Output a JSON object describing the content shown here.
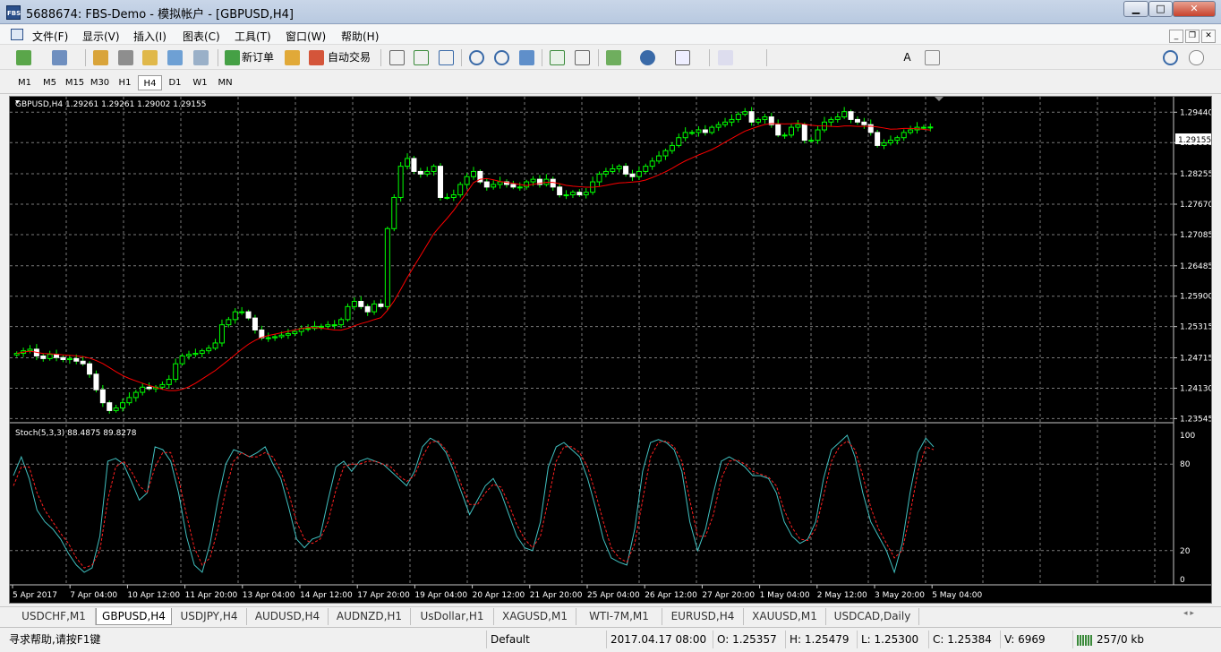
{
  "window": {
    "title": "5688674: FBS-Demo - 模拟帐户 - [GBPUSD,H4]",
    "app_icon_text": "FBS",
    "buttons": [
      "minimize-icon",
      "maximize-icon",
      "close-icon"
    ]
  },
  "menu": {
    "items": [
      "文件(F)",
      "显示(V)",
      "插入(I)",
      "图表(C)",
      "工具(T)",
      "窗口(W)",
      "帮助(H)"
    ]
  },
  "toolbar": {
    "new_order_label": "新订单",
    "auto_trade_label": "自动交易"
  },
  "timeframes": {
    "items": [
      "M1",
      "M5",
      "M15",
      "M30",
      "H1",
      "H4",
      "D1",
      "W1",
      "MN"
    ],
    "active": "H4"
  },
  "chart_data": [
    {
      "type": "candlestick",
      "title": "GBPUSD,H4  1.29261 1.29261 1.29002 1.29155",
      "symbol": "GBPUSD",
      "timeframe": "H4",
      "ohlc_last": {
        "open": 1.29261,
        "high": 1.29261,
        "low": 1.29002,
        "close": 1.29155
      },
      "current_price_label": "1.29155",
      "ylim": [
        1.235,
        1.296
      ],
      "y_ticks": [
        "1.29440",
        "1.28855",
        "1.28255",
        "1.27670",
        "1.27085",
        "1.26485",
        "1.25900",
        "1.25315",
        "1.24715",
        "1.24130",
        "1.23545"
      ],
      "grid": true,
      "bull_color": "#00ff00",
      "bear_color": "#ffffff",
      "ma_color": "#ff0000",
      "close_series": [
        1.248,
        1.2485,
        1.2488,
        1.2475,
        1.247,
        1.2478,
        1.2472,
        1.2468,
        1.247,
        1.2465,
        1.246,
        1.244,
        1.241,
        1.2385,
        1.237,
        1.2375,
        1.2385,
        1.2395,
        1.2405,
        1.2415,
        1.2412,
        1.2415,
        1.242,
        1.243,
        1.246,
        1.2475,
        1.2478,
        1.248,
        1.2485,
        1.249,
        1.25,
        1.2535,
        1.2545,
        1.256,
        1.256,
        1.2548,
        1.2525,
        1.251,
        1.251,
        1.2512,
        1.2515,
        1.2518,
        1.2522,
        1.2528,
        1.2528,
        1.2532,
        1.2532,
        1.2535,
        1.2535,
        1.2545,
        1.257,
        1.258,
        1.257,
        1.256,
        1.2575,
        1.257,
        1.272,
        1.278,
        1.284,
        1.2855,
        1.283,
        1.2825,
        1.283,
        1.284,
        1.278,
        1.278,
        1.2785,
        1.2805,
        1.282,
        1.283,
        1.281,
        1.28,
        1.2805,
        1.281,
        1.2805,
        1.28,
        1.28,
        1.281,
        1.2815,
        1.2805,
        1.2815,
        1.28,
        1.2785,
        1.2785,
        1.279,
        1.2785,
        1.279,
        1.281,
        1.2825,
        1.283,
        1.2835,
        1.284,
        1.2825,
        1.282,
        1.283,
        1.284,
        1.285,
        1.286,
        1.287,
        1.288,
        1.2895,
        1.2905,
        1.2905,
        1.291,
        1.2905,
        1.2915,
        1.292,
        1.2925,
        1.293,
        1.294,
        1.2945,
        1.2925,
        1.293,
        1.2935,
        1.292,
        1.29,
        1.29,
        1.2915,
        1.292,
        1.289,
        1.289,
        1.291,
        1.2925,
        1.293,
        1.2935,
        1.2945,
        1.293,
        1.2925,
        1.292,
        1.2905,
        1.288,
        1.2885,
        1.289,
        1.2895,
        1.2905,
        1.291,
        1.2915,
        1.2915,
        1.29155
      ],
      "ma_period_note": "",
      "x_ticks": [
        "5 Apr 2017",
        "7 Apr 04:00",
        "10 Apr 12:00",
        "11 Apr 20:00",
        "13 Apr 04:00",
        "14 Apr 12:00",
        "17 Apr 20:00",
        "19 Apr 04:00",
        "20 Apr 12:00",
        "21 Apr 20:00",
        "25 Apr 04:00",
        "26 Apr 12:00",
        "27 Apr 20:00",
        "1 May 04:00",
        "2 May 12:00",
        "3 May 20:00",
        "5 May 04:00"
      ]
    },
    {
      "type": "line",
      "title": "Stoch(5,3,3) 88.4875 89.8278",
      "ylim": [
        0,
        100
      ],
      "y_ticks": [
        "100",
        "80",
        "20",
        "0"
      ],
      "series": [
        {
          "name": "main",
          "color": "#40c0c0",
          "values": [
            72,
            85,
            70,
            48,
            40,
            35,
            28,
            18,
            10,
            5,
            8,
            30,
            82,
            84,
            80,
            68,
            55,
            60,
            92,
            90,
            82,
            60,
            30,
            10,
            5,
            25,
            55,
            80,
            90,
            88,
            85,
            88,
            92,
            80,
            70,
            50,
            28,
            22,
            28,
            30,
            55,
            78,
            82,
            75,
            82,
            84,
            82,
            80,
            75,
            70,
            65,
            75,
            92,
            98,
            95,
            88,
            75,
            60,
            45,
            55,
            65,
            70,
            60,
            45,
            30,
            22,
            20,
            40,
            78,
            92,
            95,
            90,
            85,
            70,
            50,
            28,
            15,
            12,
            10,
            35,
            75,
            95,
            97,
            95,
            90,
            75,
            40,
            20,
            35,
            60,
            82,
            85,
            82,
            78,
            72,
            72,
            70,
            60,
            40,
            30,
            25,
            28,
            40,
            70,
            90,
            95,
            100,
            85,
            60,
            40,
            30,
            20,
            5,
            25,
            60,
            88,
            98,
            92
          ]
        },
        {
          "name": "signal",
          "color": "#ff2020",
          "values": [
            65,
            78,
            78,
            60,
            48,
            40,
            32,
            25,
            15,
            8,
            10,
            20,
            55,
            78,
            82,
            75,
            65,
            60,
            78,
            88,
            88,
            70,
            45,
            22,
            10,
            15,
            35,
            62,
            82,
            88,
            85,
            85,
            88,
            85,
            75,
            60,
            40,
            28,
            25,
            28,
            40,
            62,
            78,
            80,
            80,
            82,
            82,
            80,
            78,
            72,
            68,
            72,
            85,
            95,
            96,
            90,
            80,
            65,
            52,
            52,
            60,
            66,
            64,
            52,
            38,
            28,
            22,
            30,
            55,
            82,
            92,
            92,
            88,
            78,
            60,
            40,
            22,
            15,
            12,
            25,
            55,
            85,
            95,
            96,
            92,
            82,
            55,
            30,
            30,
            45,
            70,
            82,
            83,
            80,
            75,
            73,
            71,
            65,
            48,
            36,
            28,
            27,
            35,
            58,
            82,
            92,
            96,
            90,
            72,
            50,
            35,
            25,
            15,
            20,
            45,
            75,
            92,
            90
          ]
        }
      ]
    }
  ],
  "symbol_tabs": {
    "items": [
      "USDCHF,M1",
      "GBPUSD,H4",
      "USDJPY,H4",
      "AUDUSD,H4",
      "AUDNZD,H1",
      "UsDollar,H1",
      "XAGUSD,M1",
      "WTI-7M,M1",
      "EURUSD,H4",
      "XAUUSD,M1",
      "USDCAD,Daily"
    ],
    "active": "GBPUSD,H4"
  },
  "status": {
    "help": "寻求帮助,请按F1键",
    "profile": "Default",
    "datetime": "2017.04.17 08:00",
    "open": "O: 1.25357",
    "high": "H: 1.25479",
    "low": "L: 1.25300",
    "close": "C: 1.25384",
    "volume": "V: 6969",
    "traffic": "257/0 kb"
  }
}
